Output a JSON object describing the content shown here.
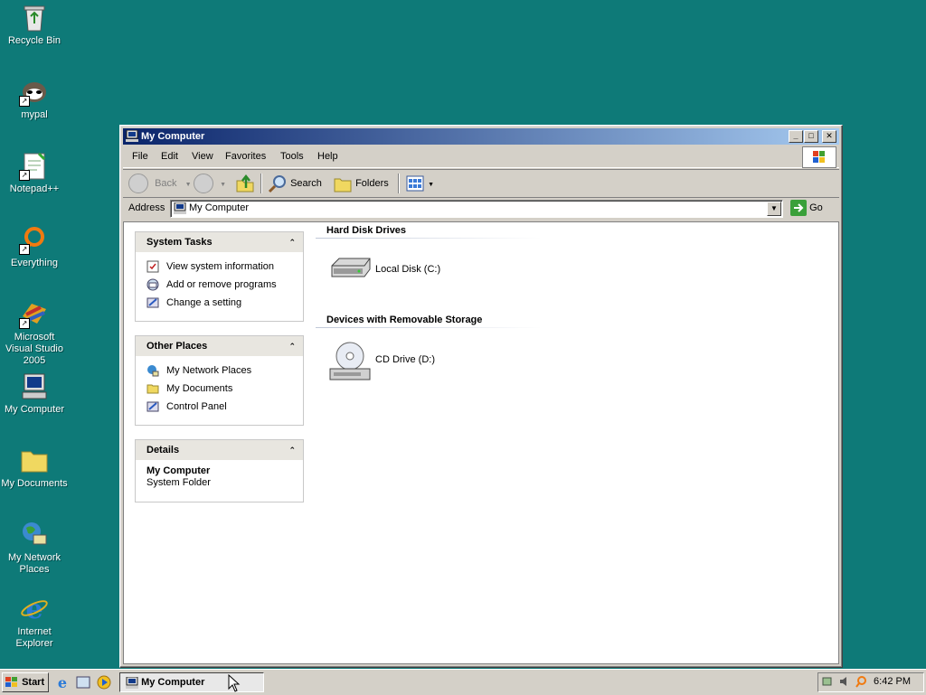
{
  "desktop": {
    "icons": [
      {
        "label": "Recycle Bin"
      },
      {
        "label": "mypal"
      },
      {
        "label": "Notepad++"
      },
      {
        "label": "Everything"
      },
      {
        "label": "Microsoft Visual Studio 2005"
      },
      {
        "label": "My Computer"
      },
      {
        "label": "My Documents"
      },
      {
        "label": "My Network Places"
      },
      {
        "label": "Internet Explorer"
      }
    ]
  },
  "window": {
    "title": "My Computer",
    "menu": [
      "File",
      "Edit",
      "View",
      "Favorites",
      "Tools",
      "Help"
    ],
    "toolbar": {
      "back_label": "Back",
      "search_label": "Search",
      "folders_label": "Folders"
    },
    "address": {
      "label": "Address",
      "value": "My Computer",
      "go_label": "Go"
    },
    "panels": {
      "system_tasks": {
        "title": "System Tasks",
        "items": [
          "View system information",
          "Add or remove programs",
          "Change a setting"
        ]
      },
      "other_places": {
        "title": "Other Places",
        "items": [
          "My Network Places",
          "My Documents",
          "Control Panel"
        ]
      },
      "details": {
        "title": "Details",
        "name": "My Computer",
        "type": "System Folder"
      }
    },
    "sections": {
      "hard_disks": {
        "title": "Hard Disk Drives",
        "items": [
          "Local Disk (C:)"
        ]
      },
      "removable": {
        "title": "Devices with Removable Storage",
        "items": [
          "CD Drive (D:)"
        ]
      }
    }
  },
  "taskbar": {
    "start_label": "Start",
    "task_label": "My Computer",
    "clock": "6:42 PM"
  },
  "colors": {
    "desktop": "#0e7a78",
    "title_start": "#0a246a",
    "title_end": "#a6caf0"
  }
}
